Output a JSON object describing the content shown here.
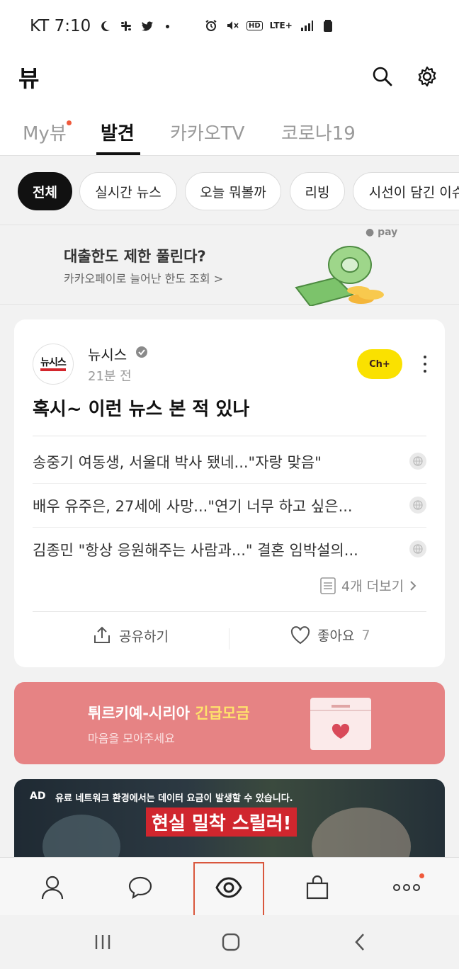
{
  "status_bar": {
    "carrier_time": "KT 7:10",
    "network": "LTE+"
  },
  "header": {
    "title": "뷰"
  },
  "tabs": [
    {
      "label": "My뷰"
    },
    {
      "label": "발견"
    },
    {
      "label": "카카오TV"
    },
    {
      "label": "코로나19"
    }
  ],
  "chips": [
    {
      "label": "전체"
    },
    {
      "label": "실시간 뉴스"
    },
    {
      "label": "오늘 뭐볼까"
    },
    {
      "label": "리빙"
    },
    {
      "label": "시선이 담긴 이슈"
    }
  ],
  "ad_banner": {
    "title": "대출한도 제한 풀린다?",
    "subtitle": "카카오페이로 늘어난 한도 조회 >",
    "badge": "pay"
  },
  "card": {
    "source_name": "뉴시스",
    "logo_text": "뉴시스",
    "time": "21분 전",
    "channel_label": "Ch+",
    "title": "혹시~ 이런 뉴스 본 적 있나",
    "items": [
      {
        "text": "송중기 여동생, 서울대 박사 됐네...\"자랑 맞음\""
      },
      {
        "text": "배우 유주은, 27세에 사망...\"연기 너무 하고 싶은..."
      },
      {
        "text": "김종민 \"항상 응원해주는 사람과...\" 결혼 임박설의..."
      }
    ],
    "more_label": "4개 더보기",
    "share_label": "공유하기",
    "like_label": "좋아요",
    "like_count": "7"
  },
  "donation": {
    "title_main": "튀르키예-시리아",
    "title_highlight": "긴급모금",
    "subtitle": "마음을 모아주세요"
  },
  "promo": {
    "ad_label": "AD",
    "notice": "유료 네트워크 환경에서는 데이터 요금이 발생할 수 있습니다.",
    "headline": "현실 밀착 스릴러!"
  },
  "colors": {
    "accent": "#f05a3c",
    "kakao_yellow": "#fae100",
    "donation_bg": "#e68384",
    "nav_highlight": "#d9573d"
  }
}
